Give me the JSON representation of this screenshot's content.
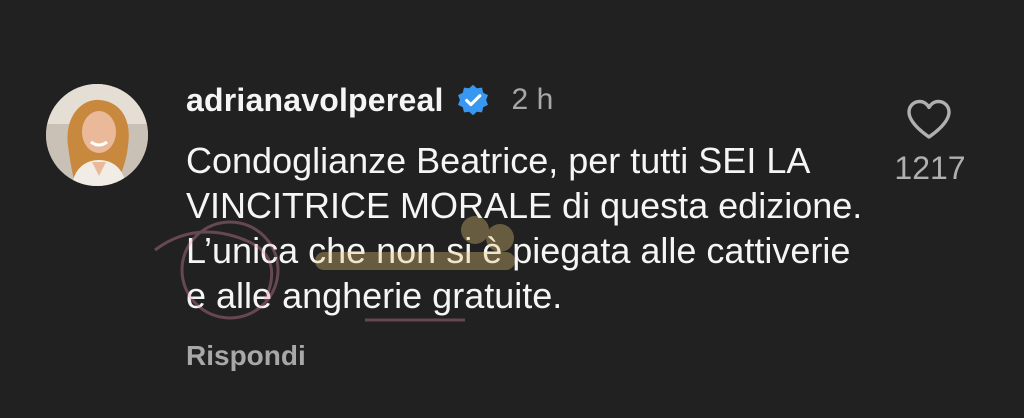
{
  "comment": {
    "username": "adrianavolpereal",
    "verified": true,
    "timestamp": "2 h",
    "text": "Condoglianze Beatrice, per tutti SEI LA VINCITRICE MORALE di questa edizione. L’unica che non si è piegata alle cattiverie e alle angherie gratuite.",
    "reply_label": "Rispondi",
    "like_count": "1217",
    "like_icon": "heart-outline-icon",
    "verified_icon": "verified-badge-icon"
  },
  "colors": {
    "background": "#212121",
    "text": "#f5f5f5",
    "muted": "#a8a8a8",
    "verified": "#3897f0"
  }
}
